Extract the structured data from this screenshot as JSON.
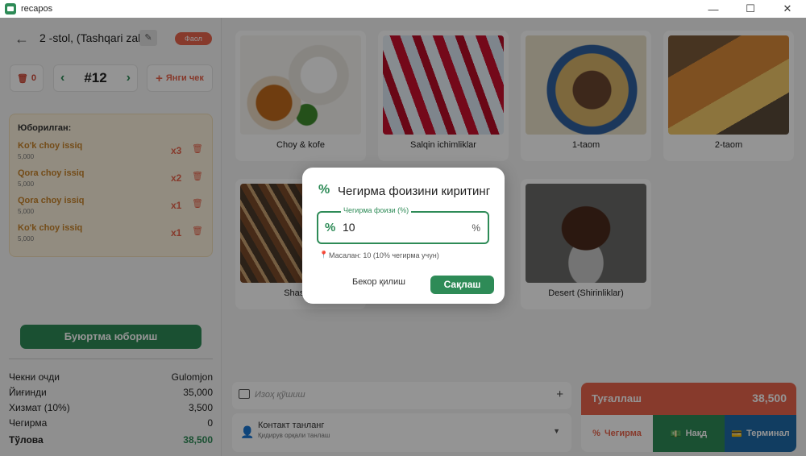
{
  "window": {
    "title": "recapos",
    "minimize": "—",
    "maximize": "☐",
    "close": "✕"
  },
  "order": {
    "table_name": "2 -stol, (Tashqari zal)",
    "status": "Фаол",
    "deleted_count": "0",
    "check_number": "#12",
    "new_check_label": "Янги чек"
  },
  "sent": {
    "title": "Юборилган:",
    "items": [
      {
        "name": "Ko'k choy issiq",
        "price": "5,000",
        "qty": "x3"
      },
      {
        "name": "Qora choy issiq",
        "price": "5,000",
        "qty": "x2"
      },
      {
        "name": "Qora choy issiq",
        "price": "5,000",
        "qty": "x1"
      },
      {
        "name": "Ko'k choy issiq",
        "price": "5,000",
        "qty": "x1"
      }
    ]
  },
  "send_order_label": "Буюртма юбориш",
  "summary": {
    "cashier_label": "Чекни очди",
    "cashier_value": "Gulomjon",
    "subtotal_label": "Йиғинди",
    "subtotal_value": "35,000",
    "service_label": "Хизмат (10%)",
    "service_value": "3,500",
    "discount_label": "Чегирма",
    "discount_value": "0",
    "total_label": "Тўлова",
    "total_value": "38,500"
  },
  "categories": [
    {
      "name": "Choy & kofe"
    },
    {
      "name": "Salqin ichimliklar"
    },
    {
      "name": "1-taom"
    },
    {
      "name": "2-taom"
    },
    {
      "name": "Shashlik"
    },
    {
      "name": "Desert (Shirinliklar)"
    }
  ],
  "comment": {
    "placeholder": "Изоҳ қўшиш",
    "add": "+"
  },
  "contact": {
    "title": "Контакт танланг",
    "subtitle": "Қидирув орқали танлаш"
  },
  "payment": {
    "finish_label": "Туғаллаш",
    "amount": "38,500",
    "discount_label": "Чегирма",
    "cash_label": "Нақд",
    "terminal_label": "Терминал"
  },
  "dialog": {
    "title": "Чегирма фоизини киритинг",
    "field_label": "Чегирма фоизи (%)",
    "field_value": "10",
    "suffix": "%",
    "hint": "Масалан: 10 (10% чегирма учун)",
    "cancel_label": "Бекор қилиш",
    "save_label": "Сақлаш"
  },
  "colors": {
    "primary": "#2e8b57",
    "accent": "#e8654d",
    "terminal": "#1e6aa8",
    "sent_bg": "#fbf1dc"
  }
}
